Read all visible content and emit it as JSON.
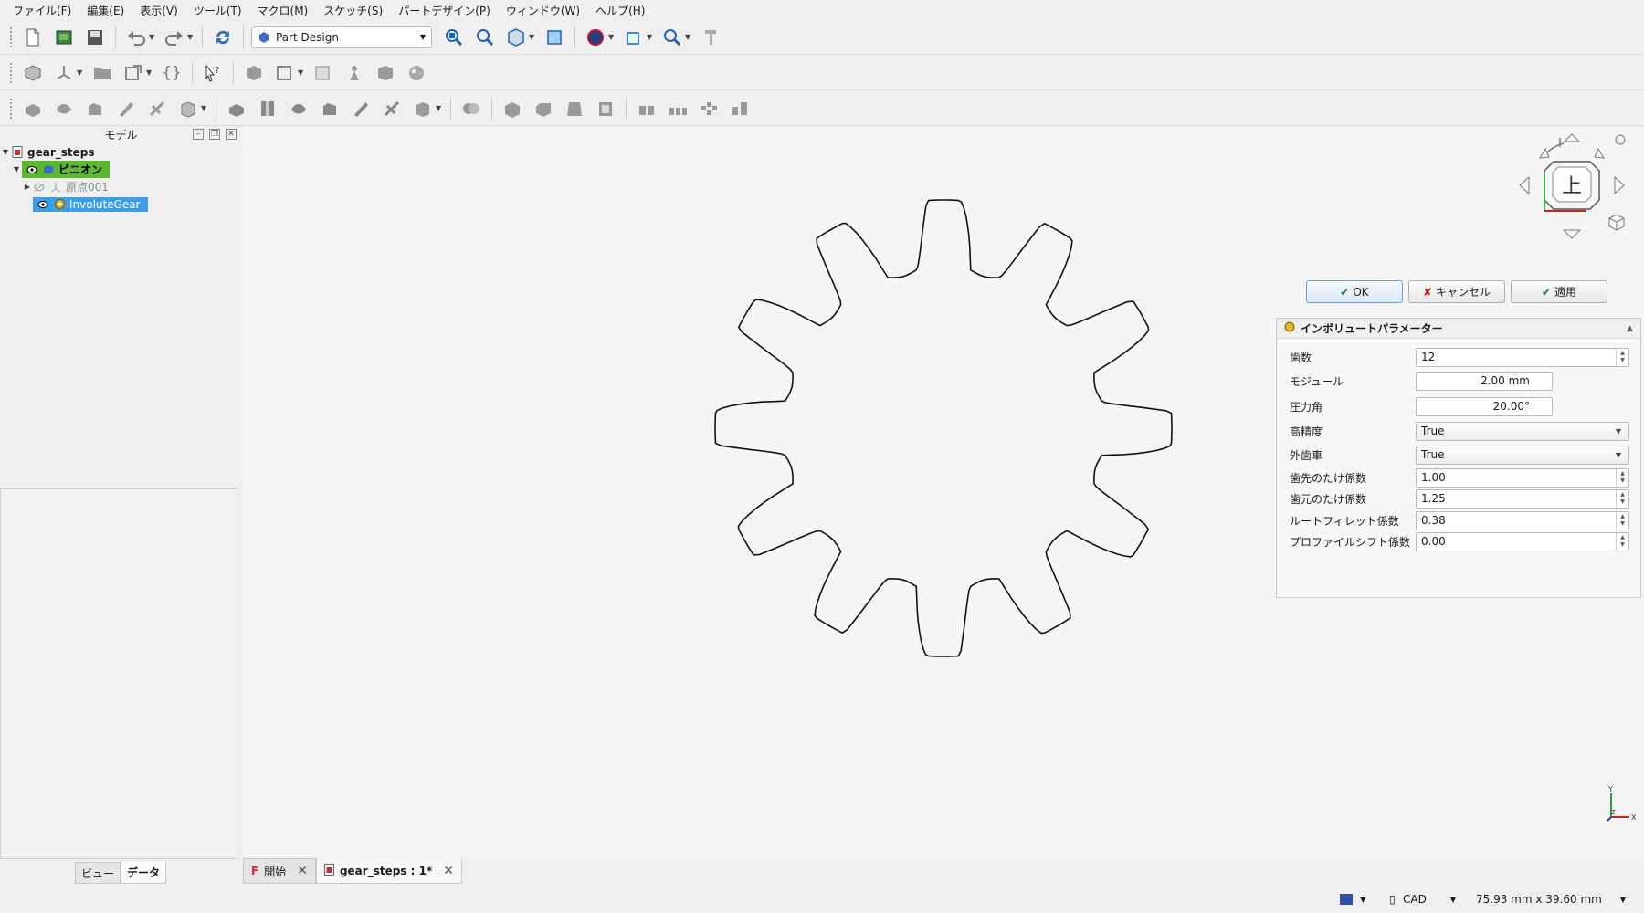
{
  "menu": [
    "ファイル(F)",
    "編集(E)",
    "表示(V)",
    "ツール(T)",
    "マクロ(M)",
    "スケッチ(S)",
    "パートデザイン(P)",
    "ウィンドウ(W)",
    "ヘルプ(H)"
  ],
  "workbench": {
    "selected": "Part Design"
  },
  "left_panel": {
    "title": "モデル",
    "tree": {
      "document": "gear_steps",
      "body": "ピニオン",
      "origin": "原点001",
      "feature": "InvoluteGear"
    },
    "tabs": {
      "view": "ビュー",
      "data": "データ"
    }
  },
  "navcube": {
    "face": "上"
  },
  "task": {
    "ok": "OK",
    "cancel": "キャンセル",
    "apply": "適用",
    "panel_title": "インボリュートパラメーター",
    "params": [
      {
        "label": "歯数",
        "value": "12"
      },
      {
        "label": "モジュール",
        "value": "2.00 mm"
      },
      {
        "label": "圧力角",
        "value": "20.00°"
      },
      {
        "label": "高精度",
        "value": "True"
      },
      {
        "label": "外歯車",
        "value": "True"
      },
      {
        "label": "歯先のたけ係数",
        "value": "1.00"
      },
      {
        "label": "歯元のたけ係数",
        "value": "1.25"
      },
      {
        "label": "ルートフィレット係数",
        "value": "0.38"
      },
      {
        "label": "プロファイルシフト係数",
        "value": "0.00"
      }
    ]
  },
  "doc_tabs": {
    "start": "開始",
    "gear": "gear_steps : 1*"
  },
  "status": {
    "nav_style": "CAD",
    "dimensions": "75.93 mm x 39.60 mm"
  },
  "axis": {
    "x": "X",
    "y": "Y",
    "z": "Z"
  },
  "colors": {
    "selection_blue": "#3d9ee8",
    "body_green": "#5cb832",
    "viewport_bg": "#f5f5f5"
  }
}
